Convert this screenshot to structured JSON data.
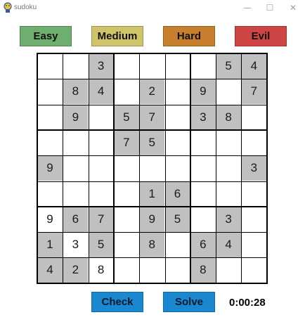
{
  "window": {
    "title": "sudoku",
    "minimize_glyph": "—",
    "maximize_glyph": "☐",
    "close_glyph": "✕"
  },
  "difficulty": [
    {
      "label": "Easy",
      "color": "#6eae6e"
    },
    {
      "label": "Medium",
      "color": "#cfc46a"
    },
    {
      "label": "Hard",
      "color": "#c77f2d"
    },
    {
      "label": "Evil",
      "color": "#cf4545"
    }
  ],
  "board": [
    [
      "",
      "",
      "3",
      "",
      "",
      "",
      "",
      "5",
      "4"
    ],
    [
      "",
      "8",
      "4",
      "",
      "2",
      "",
      "9",
      "",
      "7"
    ],
    [
      "",
      "9",
      "",
      "5",
      "7",
      "",
      "3",
      "8",
      ""
    ],
    [
      "",
      "",
      "",
      "7",
      "5",
      "",
      "",
      "",
      ""
    ],
    [
      "9",
      "",
      "",
      "",
      "",
      "",
      "",
      "",
      "3"
    ],
    [
      "",
      "",
      "",
      "",
      "1",
      "6",
      "",
      "",
      ""
    ],
    [
      "9",
      "6",
      "7",
      "",
      "9",
      "5",
      "",
      "3",
      ""
    ],
    [
      "1",
      "3",
      "5",
      "",
      "8",
      "",
      "6",
      "4",
      ""
    ],
    [
      "4",
      "2",
      "8",
      "",
      "",
      "",
      "8",
      "",
      ""
    ]
  ],
  "given_cells": [
    [
      0,
      2
    ],
    [
      0,
      7
    ],
    [
      0,
      8
    ],
    [
      1,
      1
    ],
    [
      1,
      2
    ],
    [
      1,
      4
    ],
    [
      1,
      6
    ],
    [
      1,
      8
    ],
    [
      2,
      1
    ],
    [
      2,
      3
    ],
    [
      2,
      4
    ],
    [
      2,
      6
    ],
    [
      2,
      7
    ],
    [
      3,
      3
    ],
    [
      3,
      4
    ],
    [
      4,
      0
    ],
    [
      4,
      8
    ],
    [
      5,
      4
    ],
    [
      5,
      5
    ],
    [
      6,
      1
    ],
    [
      6,
      2
    ],
    [
      6,
      4
    ],
    [
      6,
      5
    ],
    [
      6,
      7
    ],
    [
      7,
      0
    ],
    [
      7,
      2
    ],
    [
      7,
      4
    ],
    [
      7,
      6
    ],
    [
      7,
      7
    ],
    [
      8,
      0
    ],
    [
      8,
      1
    ],
    [
      8,
      6
    ]
  ],
  "actions": {
    "check_label": "Check",
    "solve_label": "Solve",
    "color": "#1a88d0"
  },
  "timer": "0:00:28"
}
